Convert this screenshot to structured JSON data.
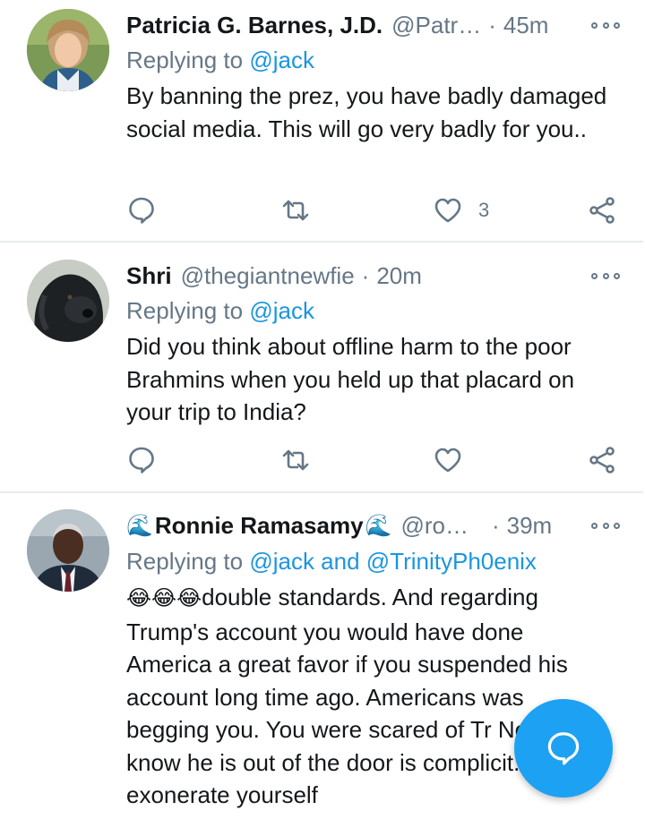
{
  "tweets": [
    {
      "name": "Patricia G. Barnes, J.D.",
      "handle": "@Patr…",
      "separator": "·",
      "time": "45m",
      "replying_prefix": "Replying to ",
      "replying_to": "@jack",
      "text": "By banning the prez, you have badly damaged social media. This will go very badly for you..",
      "likes": "3"
    },
    {
      "name": "Shri",
      "handle": "@thegiantnewfie",
      "separator": "·",
      "time": "20m",
      "replying_prefix": "Replying to ",
      "replying_to": "@jack",
      "text": "Did you think about offline harm to the poor Brahmins when you held up that placard on your trip to India?",
      "likes": ""
    },
    {
      "name": "Ronnie Ramasamy",
      "name_emoji": "🌊",
      "handle": "@ro…",
      "separator": "·",
      "time": "39m",
      "replying_prefix": "Replying to ",
      "replying_to": "@jack and @TrinityPh0enix",
      "text_emoji": "😂😂😂",
      "text": "double standards. And regarding Trump's account you would have done America a great favor if you suspended his account long time ago. Americans was begging you. You were scared of Tr Now you know he is out of the door is complicit. Don't exonerate yourself",
      "likes": ""
    }
  ],
  "icons": {
    "reply": "reply-icon",
    "retweet": "retweet-icon",
    "like": "heart-icon",
    "share": "share-icon",
    "more": "more-icon",
    "compose": "compose-reply-icon"
  },
  "colors": {
    "accent": "#1da1f2",
    "mention": "#1b95e0",
    "muted": "#657786",
    "text": "#14171a"
  }
}
